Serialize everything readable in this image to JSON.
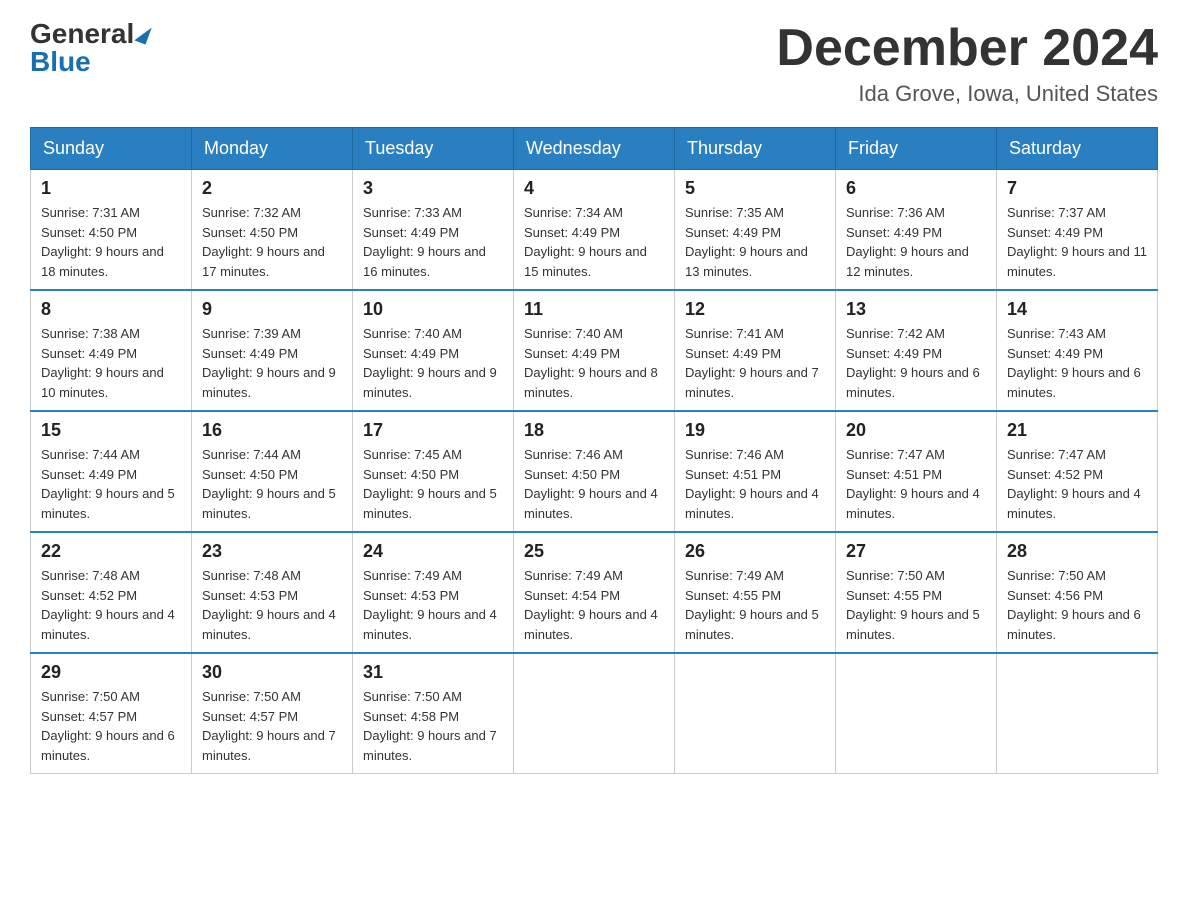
{
  "header": {
    "logo_general": "General",
    "logo_blue": "Blue",
    "month_title": "December 2024",
    "location": "Ida Grove, Iowa, United States"
  },
  "weekdays": [
    "Sunday",
    "Monday",
    "Tuesday",
    "Wednesday",
    "Thursday",
    "Friday",
    "Saturday"
  ],
  "weeks": [
    [
      {
        "day": "1",
        "sunrise": "Sunrise: 7:31 AM",
        "sunset": "Sunset: 4:50 PM",
        "daylight": "Daylight: 9 hours and 18 minutes."
      },
      {
        "day": "2",
        "sunrise": "Sunrise: 7:32 AM",
        "sunset": "Sunset: 4:50 PM",
        "daylight": "Daylight: 9 hours and 17 minutes."
      },
      {
        "day": "3",
        "sunrise": "Sunrise: 7:33 AM",
        "sunset": "Sunset: 4:49 PM",
        "daylight": "Daylight: 9 hours and 16 minutes."
      },
      {
        "day": "4",
        "sunrise": "Sunrise: 7:34 AM",
        "sunset": "Sunset: 4:49 PM",
        "daylight": "Daylight: 9 hours and 15 minutes."
      },
      {
        "day": "5",
        "sunrise": "Sunrise: 7:35 AM",
        "sunset": "Sunset: 4:49 PM",
        "daylight": "Daylight: 9 hours and 13 minutes."
      },
      {
        "day": "6",
        "sunrise": "Sunrise: 7:36 AM",
        "sunset": "Sunset: 4:49 PM",
        "daylight": "Daylight: 9 hours and 12 minutes."
      },
      {
        "day": "7",
        "sunrise": "Sunrise: 7:37 AM",
        "sunset": "Sunset: 4:49 PM",
        "daylight": "Daylight: 9 hours and 11 minutes."
      }
    ],
    [
      {
        "day": "8",
        "sunrise": "Sunrise: 7:38 AM",
        "sunset": "Sunset: 4:49 PM",
        "daylight": "Daylight: 9 hours and 10 minutes."
      },
      {
        "day": "9",
        "sunrise": "Sunrise: 7:39 AM",
        "sunset": "Sunset: 4:49 PM",
        "daylight": "Daylight: 9 hours and 9 minutes."
      },
      {
        "day": "10",
        "sunrise": "Sunrise: 7:40 AM",
        "sunset": "Sunset: 4:49 PM",
        "daylight": "Daylight: 9 hours and 9 minutes."
      },
      {
        "day": "11",
        "sunrise": "Sunrise: 7:40 AM",
        "sunset": "Sunset: 4:49 PM",
        "daylight": "Daylight: 9 hours and 8 minutes."
      },
      {
        "day": "12",
        "sunrise": "Sunrise: 7:41 AM",
        "sunset": "Sunset: 4:49 PM",
        "daylight": "Daylight: 9 hours and 7 minutes."
      },
      {
        "day": "13",
        "sunrise": "Sunrise: 7:42 AM",
        "sunset": "Sunset: 4:49 PM",
        "daylight": "Daylight: 9 hours and 6 minutes."
      },
      {
        "day": "14",
        "sunrise": "Sunrise: 7:43 AM",
        "sunset": "Sunset: 4:49 PM",
        "daylight": "Daylight: 9 hours and 6 minutes."
      }
    ],
    [
      {
        "day": "15",
        "sunrise": "Sunrise: 7:44 AM",
        "sunset": "Sunset: 4:49 PM",
        "daylight": "Daylight: 9 hours and 5 minutes."
      },
      {
        "day": "16",
        "sunrise": "Sunrise: 7:44 AM",
        "sunset": "Sunset: 4:50 PM",
        "daylight": "Daylight: 9 hours and 5 minutes."
      },
      {
        "day": "17",
        "sunrise": "Sunrise: 7:45 AM",
        "sunset": "Sunset: 4:50 PM",
        "daylight": "Daylight: 9 hours and 5 minutes."
      },
      {
        "day": "18",
        "sunrise": "Sunrise: 7:46 AM",
        "sunset": "Sunset: 4:50 PM",
        "daylight": "Daylight: 9 hours and 4 minutes."
      },
      {
        "day": "19",
        "sunrise": "Sunrise: 7:46 AM",
        "sunset": "Sunset: 4:51 PM",
        "daylight": "Daylight: 9 hours and 4 minutes."
      },
      {
        "day": "20",
        "sunrise": "Sunrise: 7:47 AM",
        "sunset": "Sunset: 4:51 PM",
        "daylight": "Daylight: 9 hours and 4 minutes."
      },
      {
        "day": "21",
        "sunrise": "Sunrise: 7:47 AM",
        "sunset": "Sunset: 4:52 PM",
        "daylight": "Daylight: 9 hours and 4 minutes."
      }
    ],
    [
      {
        "day": "22",
        "sunrise": "Sunrise: 7:48 AM",
        "sunset": "Sunset: 4:52 PM",
        "daylight": "Daylight: 9 hours and 4 minutes."
      },
      {
        "day": "23",
        "sunrise": "Sunrise: 7:48 AM",
        "sunset": "Sunset: 4:53 PM",
        "daylight": "Daylight: 9 hours and 4 minutes."
      },
      {
        "day": "24",
        "sunrise": "Sunrise: 7:49 AM",
        "sunset": "Sunset: 4:53 PM",
        "daylight": "Daylight: 9 hours and 4 minutes."
      },
      {
        "day": "25",
        "sunrise": "Sunrise: 7:49 AM",
        "sunset": "Sunset: 4:54 PM",
        "daylight": "Daylight: 9 hours and 4 minutes."
      },
      {
        "day": "26",
        "sunrise": "Sunrise: 7:49 AM",
        "sunset": "Sunset: 4:55 PM",
        "daylight": "Daylight: 9 hours and 5 minutes."
      },
      {
        "day": "27",
        "sunrise": "Sunrise: 7:50 AM",
        "sunset": "Sunset: 4:55 PM",
        "daylight": "Daylight: 9 hours and 5 minutes."
      },
      {
        "day": "28",
        "sunrise": "Sunrise: 7:50 AM",
        "sunset": "Sunset: 4:56 PM",
        "daylight": "Daylight: 9 hours and 6 minutes."
      }
    ],
    [
      {
        "day": "29",
        "sunrise": "Sunrise: 7:50 AM",
        "sunset": "Sunset: 4:57 PM",
        "daylight": "Daylight: 9 hours and 6 minutes."
      },
      {
        "day": "30",
        "sunrise": "Sunrise: 7:50 AM",
        "sunset": "Sunset: 4:57 PM",
        "daylight": "Daylight: 9 hours and 7 minutes."
      },
      {
        "day": "31",
        "sunrise": "Sunrise: 7:50 AM",
        "sunset": "Sunset: 4:58 PM",
        "daylight": "Daylight: 9 hours and 7 minutes."
      },
      null,
      null,
      null,
      null
    ]
  ]
}
